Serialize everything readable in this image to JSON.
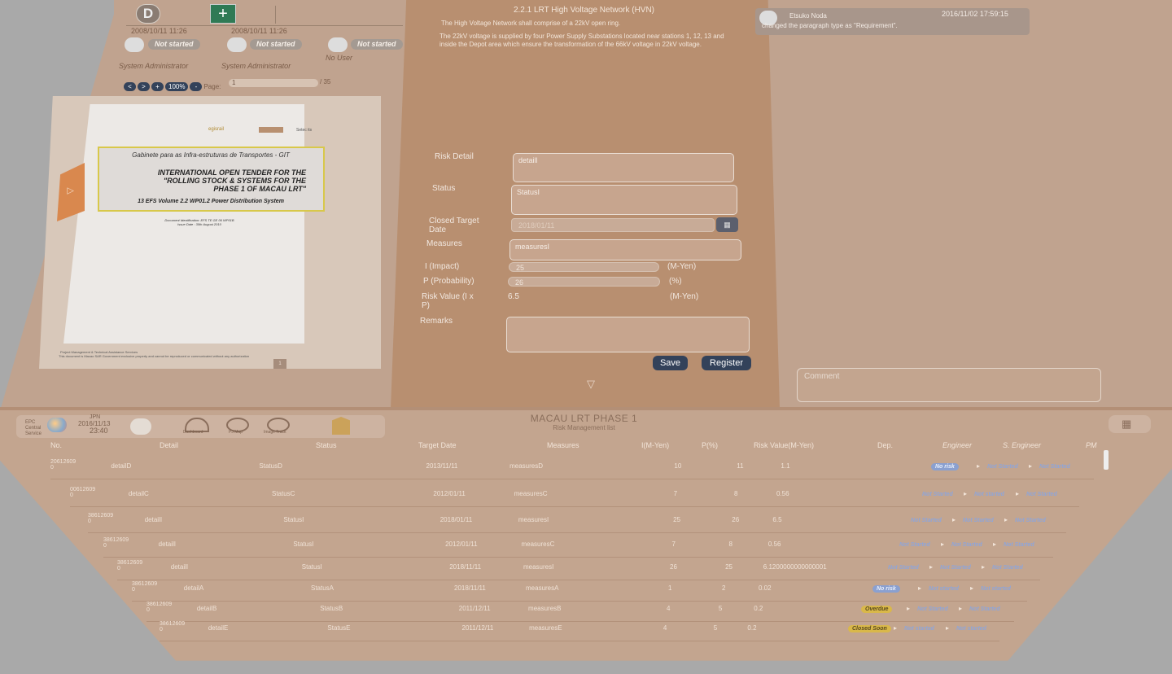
{
  "top_left": {
    "avatar_letter": "D",
    "add_label": "+",
    "timestamps": [
      "2008/10/11 11:26",
      "2008/10/11 11:26"
    ],
    "assignees": [
      {
        "status": "Not started",
        "user": "System Administrator"
      },
      {
        "status": "Not started",
        "user": "System Administrator"
      },
      {
        "status": "Not started",
        "user": "No User"
      }
    ],
    "viewer": {
      "buttons": [
        "<",
        ">",
        "+",
        "100%",
        "-"
      ],
      "page_label": "Page:",
      "page_value": "1",
      "page_total": "/ 35"
    },
    "document": {
      "logo_1": "egisrail",
      "logo_3": "Setec its",
      "org": "Gabinete para as Infra-estruturas de Transportes - GIT",
      "title_1": "INTERNATIONAL OPEN TENDER FOR THE",
      "title_2": "\"ROLLING STOCK & SYSTEMS FOR THE",
      "title_3": "PHASE 1 OF MACAU LRT\"",
      "volume": "13 EFS Volume 2.2 WP01.2 Power Distribution System",
      "meta_1": "Document Identification: EFS TE GE 06 WP01B",
      "meta_2": "Issue Date : 30th August 2010",
      "footer_1": "Project Management & Technical Assistance Services",
      "footer_2": "This document is Macao SAR Government exclusive property and cannot be reproduced or communicated without any authorization",
      "page_no": "1"
    }
  },
  "middle": {
    "section_title": "2.2.1 LRT High Voltage Network (HVN)",
    "para_1": "The High Voltage Network shall comprise of a 22kV open ring.",
    "para_2": "The 22kV voltage is supplied by four Power Supply Substations located near stations 1, 12, 13 and inside the Depot area which ensure the transformation of the 66kV voltage in 22kV voltage.",
    "labels": {
      "risk_detail": "Risk Detail",
      "status": "Status",
      "closed_target_date": "Closed Target Date",
      "measures": "Measures",
      "impact": "I (Impact)",
      "probability": "P (Probability)",
      "risk_value": "Risk Value (I x P)",
      "remarks": "Remarks"
    },
    "values": {
      "risk_detail": "detaill",
      "status": "StatusI",
      "closed_target_date": "2018/01/11",
      "measures": "measuresI",
      "impact": "25",
      "probability": "26",
      "risk_value": "6.5",
      "remarks": ""
    },
    "units": {
      "impact": "(M-Yen)",
      "probability": "(%)",
      "risk_value": "(M-Yen)"
    },
    "save": "Save",
    "register": "Register",
    "expand_glyph": "▽"
  },
  "right": {
    "comment_user": "Etsuko Noda",
    "comment_time": "2016/11/02 17:59:15",
    "comment_text": "changed the paragraph type as \"Requirement\".",
    "comment_placeholder": "Comment"
  },
  "bottom": {
    "tool": {
      "left_text": "EPC Central Service",
      "locale": "JPN",
      "date": "2016/11/13",
      "time": "23:40",
      "dashboard": "Dashboard",
      "pj_map": "PJ Map",
      "image_track": "Image Track"
    },
    "title": "MACAU LRT PHASE 1",
    "subtitle": "Risk Management list",
    "headers": [
      "No.",
      "Detail",
      "Status",
      "Target Date",
      "Measures",
      "I(M-Yen)",
      "P(%)",
      "Risk Value(M-Yen)",
      "Dep.",
      "Engineer",
      "S. Engineer",
      "PM"
    ],
    "rows": [
      {
        "no": "20612609 0",
        "detail": "detailD",
        "status": "StatusD",
        "date": "2013/11/11",
        "measures": "measuresD",
        "i": "10",
        "p": "11",
        "rv": "1.1",
        "badges": [
          "No risk",
          "Not Started",
          "Not Started"
        ]
      },
      {
        "no": "00612609 0",
        "detail": "detailC",
        "status": "StatusC",
        "date": "2012/01/11",
        "measures": "measuresC",
        "i": "7",
        "p": "8",
        "rv": "0.56",
        "badges": [
          "Not Started",
          "Not started",
          "Not Started"
        ]
      },
      {
        "no": "38612609 0",
        "detail": "detailI",
        "status": "StatusI",
        "date": "2018/01/11",
        "measures": "measuresI",
        "i": "25",
        "p": "26",
        "rv": "6.5",
        "badges": [
          "Not Started",
          "Not Started",
          "Not Started"
        ]
      },
      {
        "no": "38612609 0",
        "detail": "detailI",
        "status": "StatusI",
        "date": "2012/01/11",
        "measures": "measuresC",
        "i": "7",
        "p": "8",
        "rv": "0.56",
        "badges": [
          "Not Started",
          "Not Started",
          "Not Started"
        ]
      },
      {
        "no": "38612609 0",
        "detail": "detailI",
        "status": "StatusI",
        "date": "2018/11/11",
        "measures": "measuresI",
        "i": "26",
        "p": "25",
        "rv": "6.1200000000000001",
        "badges": [
          "Not Started",
          "Not Started",
          "Not Started"
        ]
      },
      {
        "no": "38612609 0",
        "detail": "detailA",
        "status": "StatusA",
        "date": "2018/11/11",
        "measures": "measuresA",
        "i": "1",
        "p": "2",
        "rv": "0.02",
        "badges": [
          "No risk",
          "Not started",
          "Not started"
        ]
      },
      {
        "no": "38612609 0",
        "detail": "detailB",
        "status": "StatusB",
        "date": "2011/12/11",
        "measures": "measuresB",
        "i": "4",
        "p": "5",
        "rv": "0.2",
        "badges": [
          "Overdue",
          "Not Started",
          "Not Started"
        ]
      },
      {
        "no": "38612609 0",
        "detail": "detailE",
        "status": "StatusE",
        "date": "2011/12/11",
        "measures": "measuresE",
        "i": "4",
        "p": "5",
        "rv": "0.2",
        "badges": [
          "Closed Soon",
          "Not started",
          "Not started"
        ]
      }
    ]
  },
  "colors": {
    "blue_badge": "#8aa0d0",
    "yellow_badge": "#d9b84a",
    "dark_button": "#33425a",
    "green_button": "#2f7a55"
  }
}
